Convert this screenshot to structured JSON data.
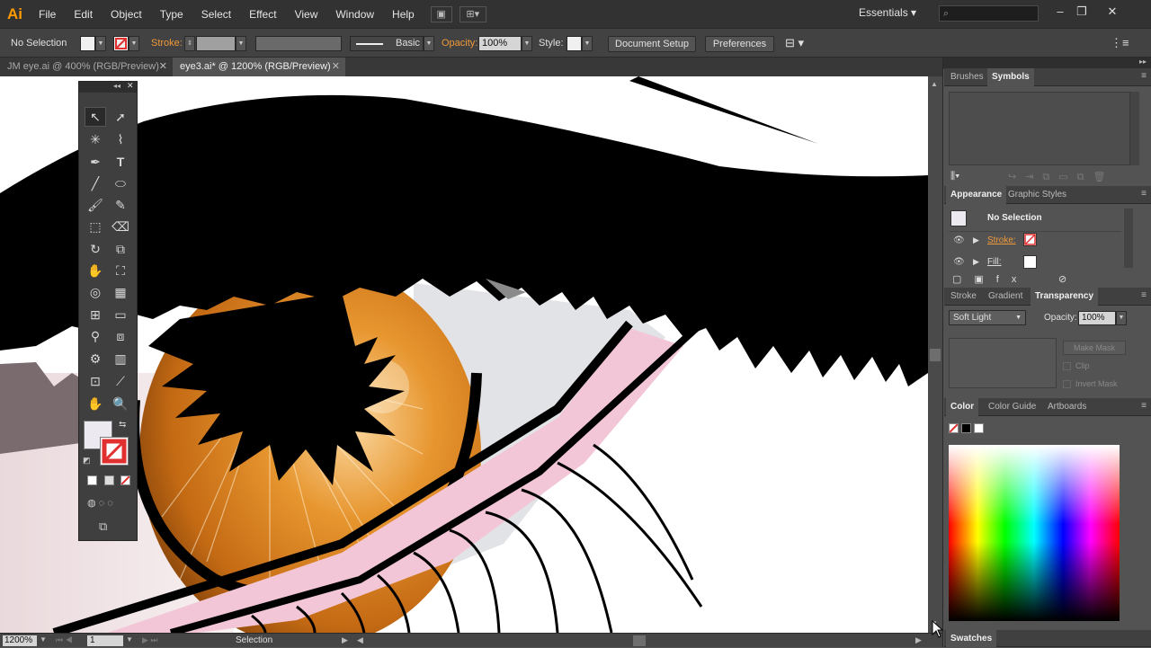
{
  "app": {
    "logo": "Ai"
  },
  "menu": [
    "File",
    "Edit",
    "Object",
    "Type",
    "Select",
    "Effect",
    "View",
    "Window",
    "Help"
  ],
  "workspace": "Essentials",
  "search": {
    "placeholder": ""
  },
  "control_bar": {
    "selection": "No Selection",
    "stroke_label": "Stroke:",
    "brush_def": "Basic",
    "opacity_label": "Opacity:",
    "opacity_value": "100%",
    "style_label": "Style:",
    "document_setup": "Document Setup",
    "preferences": "Preferences"
  },
  "tabs": [
    {
      "label": "JM eye.ai @ 400% (RGB/Preview)",
      "active": false
    },
    {
      "label": "eye3.ai* @ 1200% (RGB/Preview)",
      "active": true
    }
  ],
  "status": {
    "zoom": "1200%",
    "artboard": "1",
    "tool": "Selection"
  },
  "panels": {
    "brushes_tabs": [
      "Brushes",
      "Symbols"
    ],
    "appearance_tabs": [
      "Appearance",
      "Graphic Styles"
    ],
    "appearance": {
      "title": "No Selection",
      "stroke_label": "Stroke:",
      "fill_label": "Fill:"
    },
    "transparency_tabs": [
      "Stroke",
      "Gradient",
      "Transparency"
    ],
    "transparency": {
      "blend_mode": "Soft Light",
      "opacity_label": "Opacity:",
      "opacity_value": "100%",
      "make_mask": "Make Mask",
      "clip": "Clip",
      "invert_mask": "Invert Mask"
    },
    "color_tabs": [
      "Color",
      "Color Guide",
      "Artboards"
    ],
    "swatches_tab": "Swatches"
  },
  "colors": {
    "accent": "#ff9a00",
    "iris": "#d9801f",
    "pink": "#f2c6d6"
  }
}
